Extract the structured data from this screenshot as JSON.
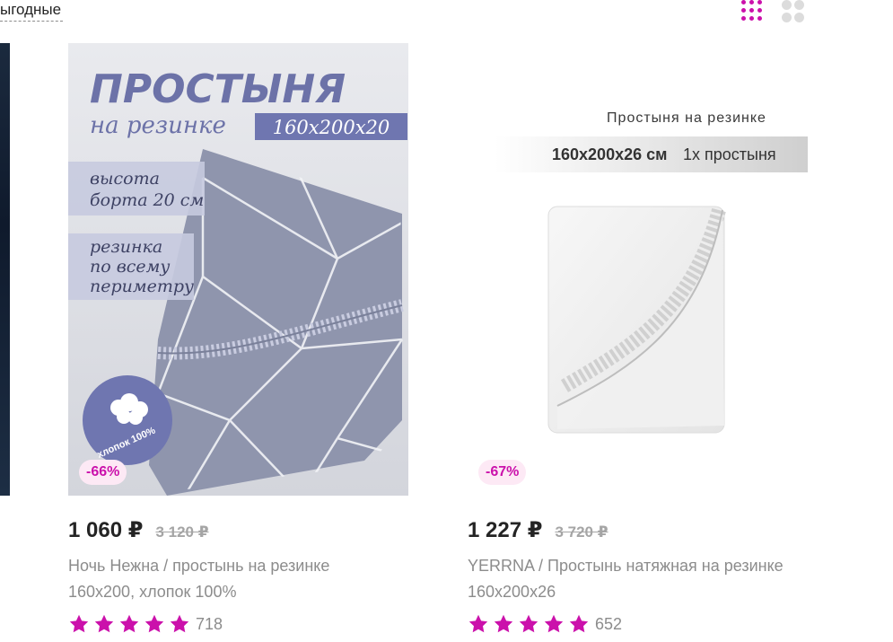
{
  "sort": {
    "label": "ыгодные"
  },
  "colors": {
    "accent": "#cb11ab",
    "accent_light": "#fde9f5",
    "muted": "#8c8c8c",
    "dots_inactive": "#dcdcdc"
  },
  "products": [
    {
      "price": "1 060 ₽",
      "old_price": "3 120 ₽",
      "discount": "-66%",
      "title": "Ночь Нежна / простынь на резинке 160х200, хлопок 100%",
      "rating": 5,
      "reviews": "718",
      "image": {
        "headline": "ПРОСТЫНЯ",
        "subline": "на резинке",
        "size": "160х200х20",
        "height_line1": "высота",
        "height_line2": "борта 20 см",
        "band_line1": "резинка",
        "band_line2": "по всему",
        "band_line3": "периметру",
        "cotton": "хлопок 100%"
      }
    },
    {
      "price": "1 227 ₽",
      "old_price": "3 720 ₽",
      "discount": "-67%",
      "title": "YERRNA / Простынь натяжная на резинке 160х200х26",
      "rating": 5,
      "reviews": "652",
      "image": {
        "headline": "Простыня на резинке",
        "size_bold": "160х200х26 см",
        "size_rest": "1х простыня"
      }
    }
  ]
}
